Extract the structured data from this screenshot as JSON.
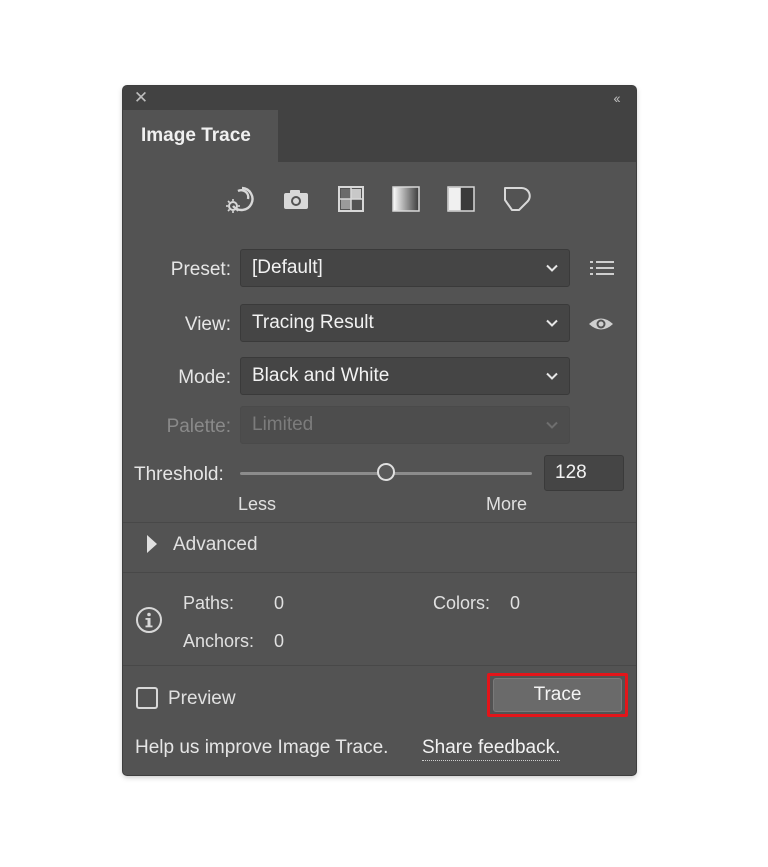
{
  "panel": {
    "tab_title": "Image Trace",
    "close_glyph": "✕",
    "collapse_glyph": "‹‹"
  },
  "preset_icons": [
    {
      "name": "auto-color-icon"
    },
    {
      "name": "high-color-icon"
    },
    {
      "name": "low-color-icon"
    },
    {
      "name": "grayscale-icon"
    },
    {
      "name": "black-and-white-icon"
    },
    {
      "name": "outline-icon"
    }
  ],
  "fields": {
    "preset_label": "Preset:",
    "preset_value": "[Default]",
    "view_label": "View:",
    "view_value": "Tracing Result",
    "mode_label": "Mode:",
    "mode_value": "Black and White",
    "palette_label": "Palette:",
    "palette_value": "Limited"
  },
  "threshold": {
    "label": "Threshold:",
    "value": "128",
    "min_label": "Less",
    "max_label": "More",
    "fraction": 0.5
  },
  "advanced_label": "Advanced",
  "stats": {
    "paths_label": "Paths:",
    "paths_value": "0",
    "colors_label": "Colors:",
    "colors_value": "0",
    "anchors_label": "Anchors:",
    "anchors_value": "0"
  },
  "preview_label": "Preview",
  "trace_label": "Trace",
  "footer": {
    "text": "Help us improve Image Trace.",
    "link": "Share feedback."
  },
  "colors": {
    "panel_bg": "#535353",
    "highlight": "#e3151a"
  }
}
